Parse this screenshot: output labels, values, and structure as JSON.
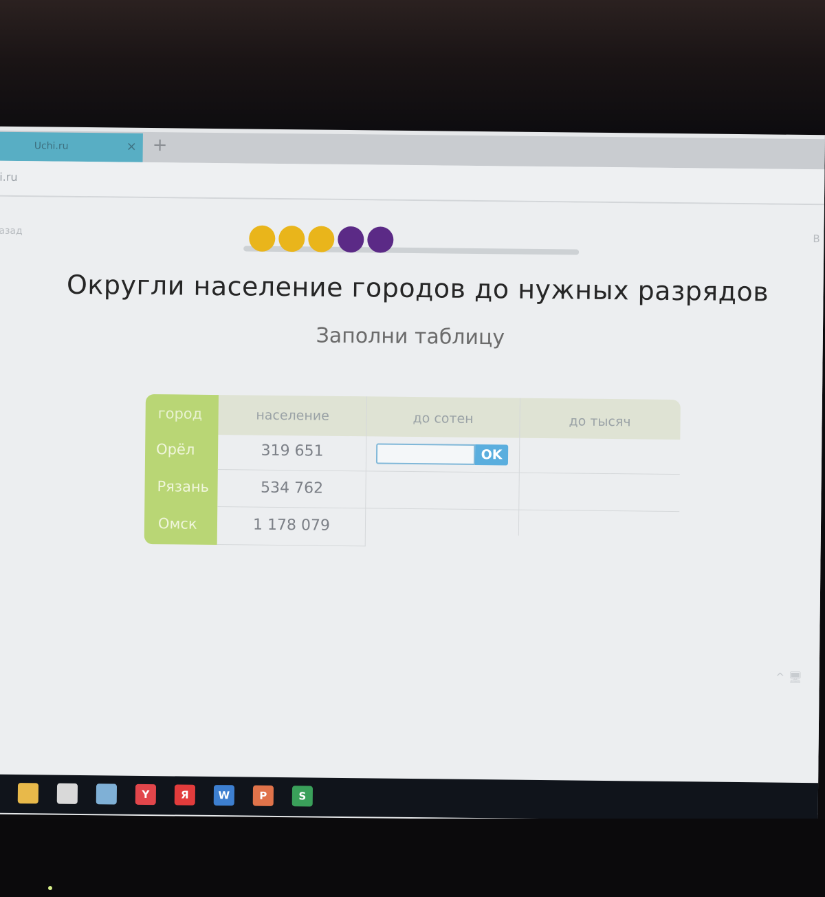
{
  "browser": {
    "tab_title": "Uchi.ru",
    "tab_close": "×",
    "new_tab": "+",
    "url": "i.ru"
  },
  "page": {
    "back_link": "азад",
    "right_link": "В",
    "progress": {
      "dots": [
        {
          "color": "#e9b51b"
        },
        {
          "color": "#e9b51b"
        },
        {
          "color": "#e9b51b"
        },
        {
          "color": "#5b2a86"
        },
        {
          "color": "#5b2a86"
        }
      ]
    },
    "title": "Округли население городов до нужных разрядов",
    "subtitle": "Заполни таблицу"
  },
  "table": {
    "headers": [
      "город",
      "население",
      "до сотен",
      "до тысяч"
    ],
    "rows": [
      {
        "city": "Орёл",
        "population": "319 651"
      },
      {
        "city": "Рязань",
        "population": "534 762"
      },
      {
        "city": "Омск",
        "population": "1 178 079"
      }
    ],
    "answer_value": "",
    "ok_label": "OK"
  },
  "taskbar": {
    "items": [
      {
        "icon": "folder-icon",
        "label": "",
        "color": "#e8b94a"
      },
      {
        "icon": "store-icon",
        "label": "",
        "color": "#d9d9d9"
      },
      {
        "icon": "app-icon",
        "label": "",
        "color": "#7fb0d6"
      },
      {
        "icon": "yandex-browser-icon",
        "label": "Y",
        "color": "#e2464b"
      },
      {
        "icon": "yandex-icon",
        "label": "Я",
        "color": "#e23c3c"
      },
      {
        "icon": "word-icon",
        "label": "W",
        "color": "#3d7fd0"
      },
      {
        "icon": "powerpoint-icon",
        "label": "P",
        "color": "#e0734a"
      },
      {
        "icon": "skype-icon",
        "label": "S",
        "color": "#3aa05a"
      }
    ],
    "tray": "^ 🖥"
  },
  "colors": {
    "accent": "#b9d675",
    "ok_button": "#5aaede",
    "progress_done": "#e9b51b",
    "progress_todo": "#5b2a86"
  }
}
